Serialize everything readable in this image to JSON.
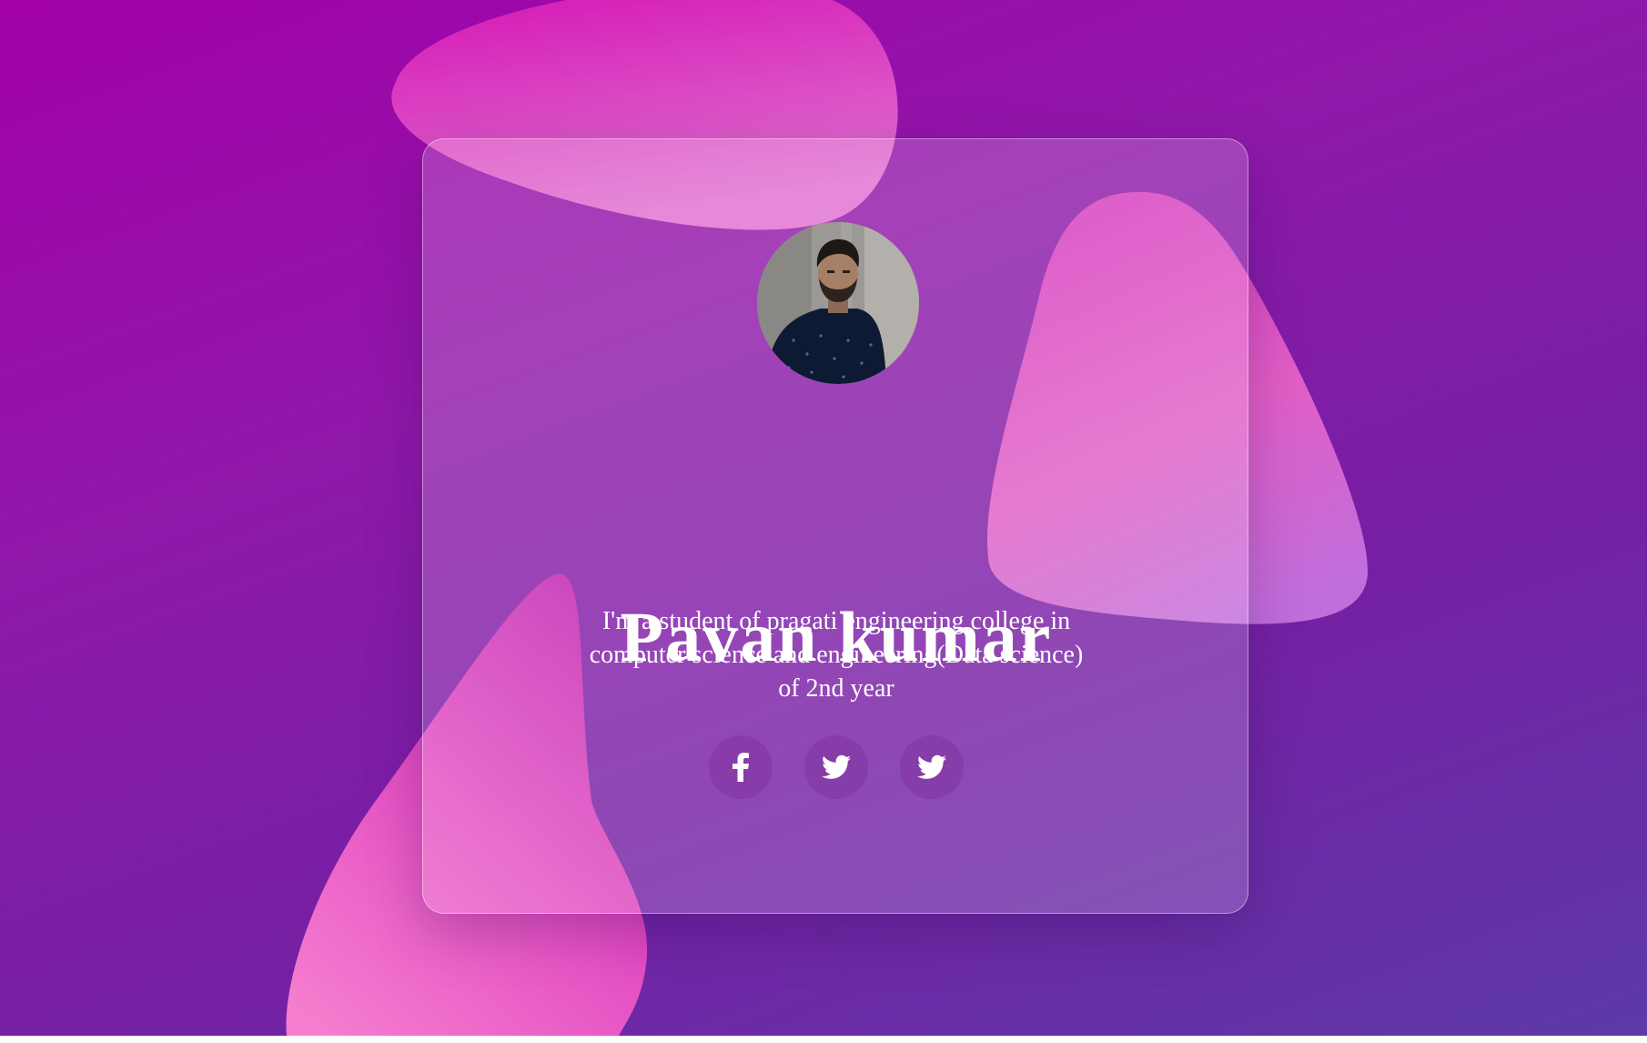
{
  "profile": {
    "name": "Pavan kumar",
    "bio": "I'm a student of pragati engineering college in computer science and engineering(Data science) of 2nd year",
    "avatar": "avatar-photo"
  },
  "social_links": [
    {
      "icon": "facebook-icon"
    },
    {
      "icon": "twitter-icon"
    },
    {
      "icon": "twitter-icon"
    }
  ],
  "colors": {
    "background_start": "#a200a9",
    "background_end": "#5d3aa7",
    "blob_pink": "#e83fc4",
    "text": "#ffffff"
  }
}
